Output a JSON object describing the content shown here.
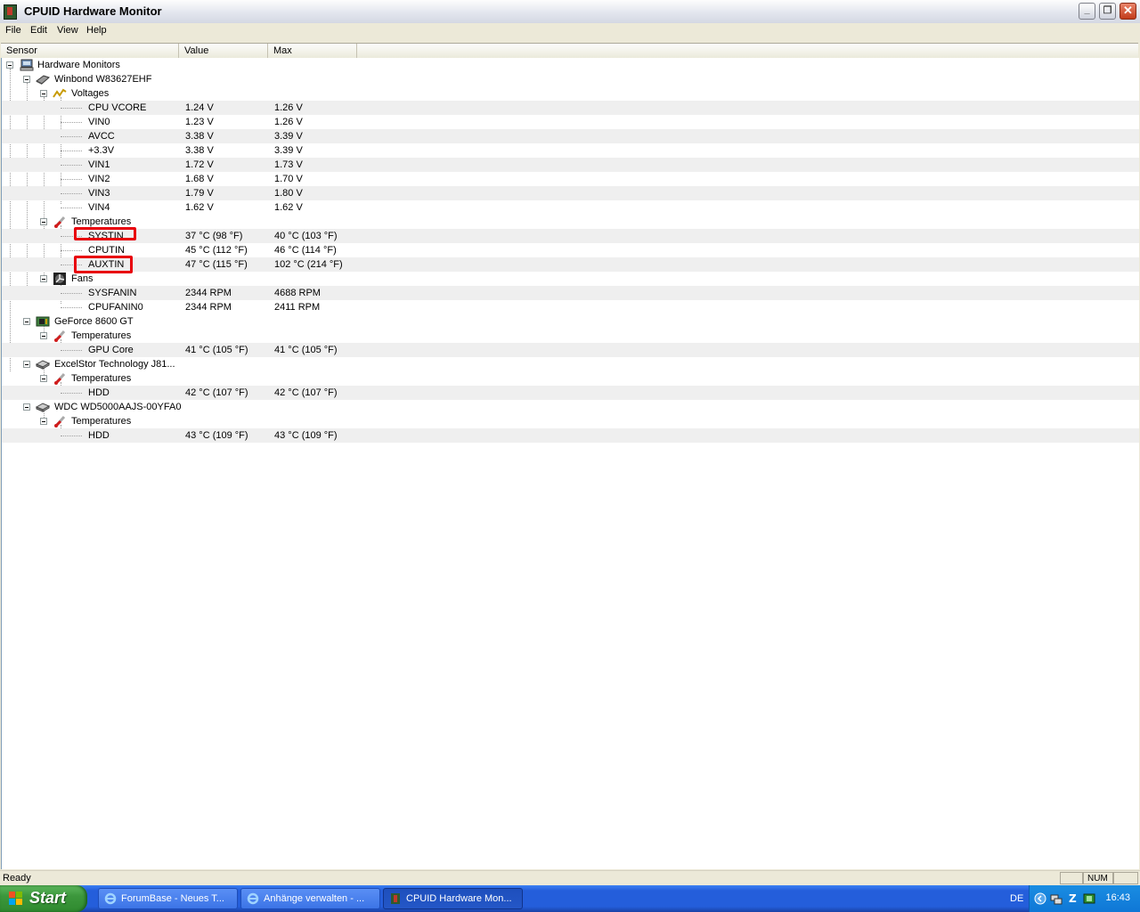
{
  "window": {
    "title": "CPUID Hardware Monitor"
  },
  "menu": [
    "File",
    "Edit",
    "View",
    "Help"
  ],
  "columns": {
    "sensor": "Sensor",
    "value": "Value",
    "max": "Max"
  },
  "tree": {
    "root": "Hardware Monitors",
    "winbond": "Winbond W83627EHF",
    "voltages": "Voltages",
    "volt_rows": [
      {
        "name": "CPU VCORE",
        "value": "1.24 V",
        "max": "1.26 V"
      },
      {
        "name": "VIN0",
        "value": "1.23 V",
        "max": "1.26 V"
      },
      {
        "name": "AVCC",
        "value": "3.38 V",
        "max": "3.39 V"
      },
      {
        "name": "+3.3V",
        "value": "3.38 V",
        "max": "3.39 V"
      },
      {
        "name": "VIN1",
        "value": "1.72 V",
        "max": "1.73 V"
      },
      {
        "name": "VIN2",
        "value": "1.68 V",
        "max": "1.70 V"
      },
      {
        "name": "VIN3",
        "value": "1.79 V",
        "max": "1.80 V"
      },
      {
        "name": "VIN4",
        "value": "1.62 V",
        "max": "1.62 V"
      }
    ],
    "temperatures": "Temperatures",
    "temp_rows": [
      {
        "name": "SYSTIN",
        "value": "37 °C  (98 °F)",
        "max": "40 °C  (103 °F)"
      },
      {
        "name": "CPUTIN",
        "value": "45 °C  (112 °F)",
        "max": "46 °C  (114 °F)"
      },
      {
        "name": "AUXTIN",
        "value": "47 °C  (115 °F)",
        "max": "102 °C  (214 °F)"
      }
    ],
    "fans": "Fans",
    "fan_rows": [
      {
        "name": "SYSFANIN",
        "value": "2344 RPM",
        "max": "4688 RPM"
      },
      {
        "name": "CPUFANIN0",
        "value": "2344 RPM",
        "max": "2411 RPM"
      }
    ],
    "geforce": "GeForce 8600 GT",
    "gpu_row": {
      "name": "GPU Core",
      "value": "41 °C  (105 °F)",
      "max": "41 °C  (105 °F)"
    },
    "excelstor": "ExcelStor Technology J81...",
    "hdd1_row": {
      "name": "HDD",
      "value": "42 °C  (107 °F)",
      "max": "42 °C  (107 °F)"
    },
    "wdc": "WDC WD5000AAJS-00YFA0",
    "hdd2_row": {
      "name": "HDD",
      "value": "43 °C  (109 °F)",
      "max": "43 °C  (109 °F)"
    }
  },
  "status": {
    "text": "Ready",
    "num": "NUM"
  },
  "taskbar": {
    "start": "Start",
    "tasks": [
      "ForumBase - Neues T...",
      "Anhänge verwalten - ...",
      "CPUID Hardware Mon..."
    ],
    "lang": "DE",
    "clock": "16:43"
  },
  "colors": {
    "highlight": "#e8000b",
    "taskbar": "#245edb",
    "start": "#3c973c"
  }
}
